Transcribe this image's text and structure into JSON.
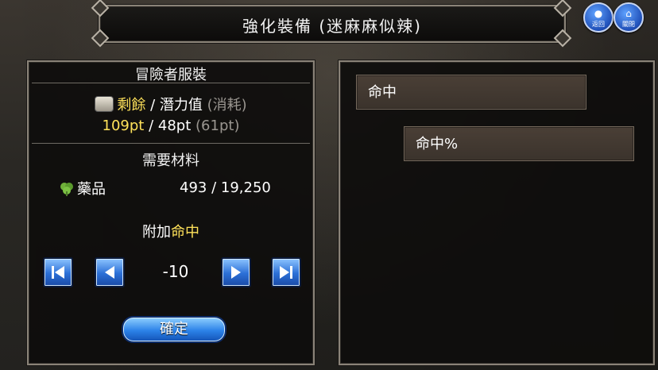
{
  "title": "強化裝備 (迷麻麻似辣)",
  "top_buttons": [
    {
      "label": "返回"
    },
    {
      "label": "關閉"
    }
  ],
  "left": {
    "header": "冒險者服裝",
    "points": {
      "label_remaining": "剩餘",
      "label_sep": "/",
      "label_potential": "潛力值",
      "label_consume": "(消耗)",
      "value_remaining": "109pt",
      "value_sep": "/",
      "value_potential": "48pt",
      "value_consume": "(61pt)"
    },
    "materials_header": "需要材料",
    "material": {
      "name": "藥品",
      "amount": "493 / 19,250"
    },
    "attach_label": "附加",
    "attach_stat": "命中",
    "step_value": "-10",
    "confirm_label": "確定"
  },
  "right": {
    "stats": [
      "命中",
      "命中%"
    ]
  },
  "colors": {
    "accent_yellow": "#ffe25a",
    "button_blue": "#2c82e8"
  }
}
